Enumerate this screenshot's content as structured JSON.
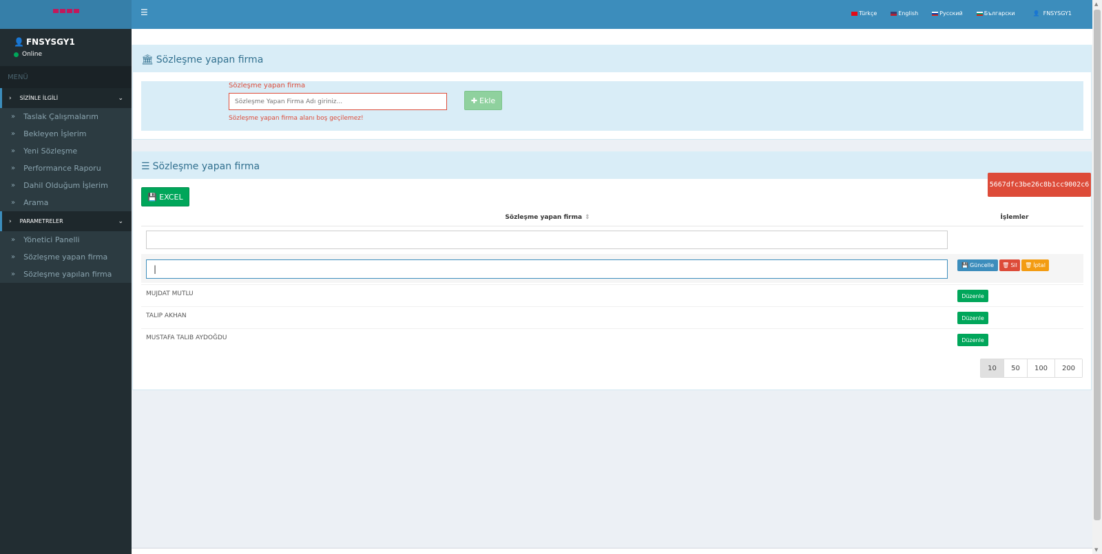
{
  "sidebar": {
    "user": {
      "name": "FNSYSGY1",
      "status": "Online"
    },
    "menu_header": "MENÜ",
    "groups": [
      {
        "label": "SİZİNLE İLGİLİ",
        "items": [
          {
            "label": "Taslak Çalışmalarım"
          },
          {
            "label": "Bekleyen İşlerim"
          },
          {
            "label": "Yeni Sözleşme"
          },
          {
            "label": "Performance Raporu"
          },
          {
            "label": "Dahil Olduğum İşlerim"
          },
          {
            "label": "Arama"
          }
        ]
      },
      {
        "label": "PARAMETRELER",
        "items": [
          {
            "label": "Yönetici Panelli"
          },
          {
            "label": "Sözleşme yapan firma"
          },
          {
            "label": "Sözleşme yapılan firma"
          }
        ]
      }
    ]
  },
  "topbar": {
    "languages": [
      "Türkçe",
      "English",
      "Русский",
      "Български"
    ],
    "user": "FNSYSGY1"
  },
  "form_box": {
    "title": "Sözleşme yapan firma",
    "label": "Sözleşme yapan firma",
    "placeholder": "Sözleşme Yapan Firma Adı giriniz...",
    "error": "Sözleşme yapan firma alanı boş geçilemez!",
    "add_button": "Ekle"
  },
  "list_box": {
    "title": "Sözleşme yapan firma",
    "hash": "5667dfc3be26c8b1cc9002c6",
    "excel_button": "EXCEL",
    "columns": [
      "Sözleşme yapan firma",
      "İşlemler"
    ],
    "edit_value": "|",
    "edit_buttons": {
      "update": "Güncelle",
      "delete": "Sil",
      "cancel": "İptal"
    },
    "rows": [
      {
        "name": "MUJDAT MUTLU",
        "action": "Düzenle"
      },
      {
        "name": "TALIP AKHAN",
        "action": "Düzenle"
      },
      {
        "name": "MUSTAFA TALIB AYDOĞDU",
        "action": "Düzenle"
      }
    ],
    "page_sizes": [
      "10",
      "50",
      "100",
      "200"
    ],
    "selected_page_size": "10"
  },
  "colors": {
    "topbar": "#3c8dbc",
    "sidebar": "#222d32",
    "danger": "#dd4b39",
    "success": "#00a65a",
    "warning": "#f39c12"
  }
}
